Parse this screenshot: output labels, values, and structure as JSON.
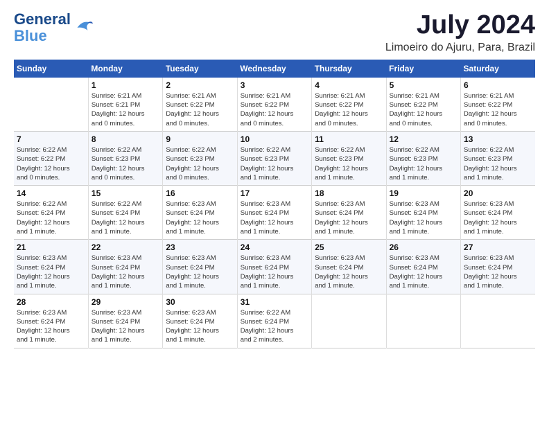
{
  "header": {
    "logo_line1": "General",
    "logo_line2": "Blue",
    "title": "July 2024",
    "subtitle": "Limoeiro do Ajuru, Para, Brazil"
  },
  "calendar": {
    "days_of_week": [
      "Sunday",
      "Monday",
      "Tuesday",
      "Wednesday",
      "Thursday",
      "Friday",
      "Saturday"
    ],
    "weeks": [
      [
        {
          "num": "",
          "info": ""
        },
        {
          "num": "1",
          "info": "Sunrise: 6:21 AM\nSunset: 6:21 PM\nDaylight: 12 hours\nand 0 minutes."
        },
        {
          "num": "2",
          "info": "Sunrise: 6:21 AM\nSunset: 6:22 PM\nDaylight: 12 hours\nand 0 minutes."
        },
        {
          "num": "3",
          "info": "Sunrise: 6:21 AM\nSunset: 6:22 PM\nDaylight: 12 hours\nand 0 minutes."
        },
        {
          "num": "4",
          "info": "Sunrise: 6:21 AM\nSunset: 6:22 PM\nDaylight: 12 hours\nand 0 minutes."
        },
        {
          "num": "5",
          "info": "Sunrise: 6:21 AM\nSunset: 6:22 PM\nDaylight: 12 hours\nand 0 minutes."
        },
        {
          "num": "6",
          "info": "Sunrise: 6:21 AM\nSunset: 6:22 PM\nDaylight: 12 hours\nand 0 minutes."
        }
      ],
      [
        {
          "num": "7",
          "info": "Sunrise: 6:22 AM\nSunset: 6:22 PM\nDaylight: 12 hours\nand 0 minutes."
        },
        {
          "num": "8",
          "info": "Sunrise: 6:22 AM\nSunset: 6:23 PM\nDaylight: 12 hours\nand 0 minutes."
        },
        {
          "num": "9",
          "info": "Sunrise: 6:22 AM\nSunset: 6:23 PM\nDaylight: 12 hours\nand 0 minutes."
        },
        {
          "num": "10",
          "info": "Sunrise: 6:22 AM\nSunset: 6:23 PM\nDaylight: 12 hours\nand 1 minute."
        },
        {
          "num": "11",
          "info": "Sunrise: 6:22 AM\nSunset: 6:23 PM\nDaylight: 12 hours\nand 1 minute."
        },
        {
          "num": "12",
          "info": "Sunrise: 6:22 AM\nSunset: 6:23 PM\nDaylight: 12 hours\nand 1 minute."
        },
        {
          "num": "13",
          "info": "Sunrise: 6:22 AM\nSunset: 6:23 PM\nDaylight: 12 hours\nand 1 minute."
        }
      ],
      [
        {
          "num": "14",
          "info": "Sunrise: 6:22 AM\nSunset: 6:24 PM\nDaylight: 12 hours\nand 1 minute."
        },
        {
          "num": "15",
          "info": "Sunrise: 6:22 AM\nSunset: 6:24 PM\nDaylight: 12 hours\nand 1 minute."
        },
        {
          "num": "16",
          "info": "Sunrise: 6:23 AM\nSunset: 6:24 PM\nDaylight: 12 hours\nand 1 minute."
        },
        {
          "num": "17",
          "info": "Sunrise: 6:23 AM\nSunset: 6:24 PM\nDaylight: 12 hours\nand 1 minute."
        },
        {
          "num": "18",
          "info": "Sunrise: 6:23 AM\nSunset: 6:24 PM\nDaylight: 12 hours\nand 1 minute."
        },
        {
          "num": "19",
          "info": "Sunrise: 6:23 AM\nSunset: 6:24 PM\nDaylight: 12 hours\nand 1 minute."
        },
        {
          "num": "20",
          "info": "Sunrise: 6:23 AM\nSunset: 6:24 PM\nDaylight: 12 hours\nand 1 minute."
        }
      ],
      [
        {
          "num": "21",
          "info": "Sunrise: 6:23 AM\nSunset: 6:24 PM\nDaylight: 12 hours\nand 1 minute."
        },
        {
          "num": "22",
          "info": "Sunrise: 6:23 AM\nSunset: 6:24 PM\nDaylight: 12 hours\nand 1 minute."
        },
        {
          "num": "23",
          "info": "Sunrise: 6:23 AM\nSunset: 6:24 PM\nDaylight: 12 hours\nand 1 minute."
        },
        {
          "num": "24",
          "info": "Sunrise: 6:23 AM\nSunset: 6:24 PM\nDaylight: 12 hours\nand 1 minute."
        },
        {
          "num": "25",
          "info": "Sunrise: 6:23 AM\nSunset: 6:24 PM\nDaylight: 12 hours\nand 1 minute."
        },
        {
          "num": "26",
          "info": "Sunrise: 6:23 AM\nSunset: 6:24 PM\nDaylight: 12 hours\nand 1 minute."
        },
        {
          "num": "27",
          "info": "Sunrise: 6:23 AM\nSunset: 6:24 PM\nDaylight: 12 hours\nand 1 minute."
        }
      ],
      [
        {
          "num": "28",
          "info": "Sunrise: 6:23 AM\nSunset: 6:24 PM\nDaylight: 12 hours\nand 1 minute."
        },
        {
          "num": "29",
          "info": "Sunrise: 6:23 AM\nSunset: 6:24 PM\nDaylight: 12 hours\nand 1 minute."
        },
        {
          "num": "30",
          "info": "Sunrise: 6:23 AM\nSunset: 6:24 PM\nDaylight: 12 hours\nand 1 minute."
        },
        {
          "num": "31",
          "info": "Sunrise: 6:22 AM\nSunset: 6:24 PM\nDaylight: 12 hours\nand 2 minutes."
        },
        {
          "num": "",
          "info": ""
        },
        {
          "num": "",
          "info": ""
        },
        {
          "num": "",
          "info": ""
        }
      ]
    ]
  }
}
